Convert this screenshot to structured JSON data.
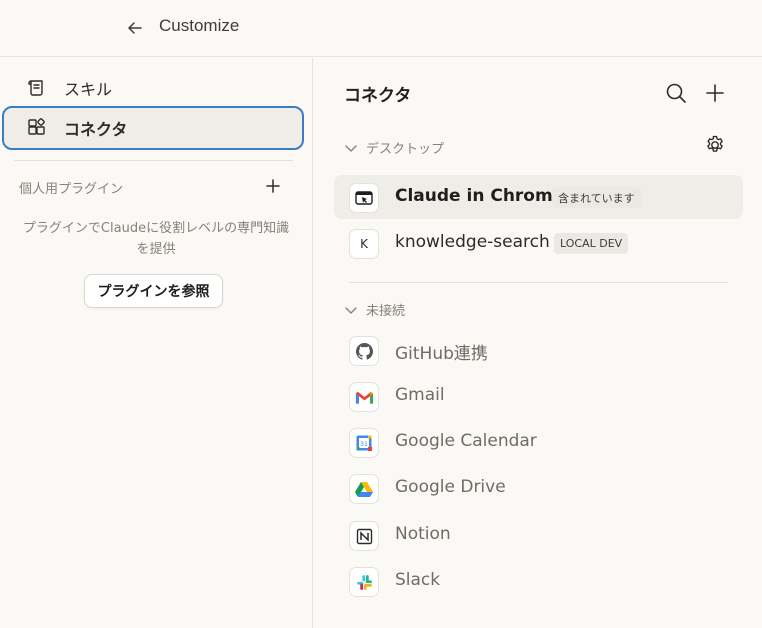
{
  "header": {
    "title": "Customize"
  },
  "sidebar": {
    "items": [
      {
        "label": "スキル"
      },
      {
        "label": "コネクタ"
      }
    ],
    "plugins": {
      "heading": "個人用プラグイン",
      "description": "プラグインでClaudeに役割レベルの専門知識を提供",
      "browse_label": "プラグインを参照"
    }
  },
  "main": {
    "title": "コネクタ",
    "desktop_section": {
      "label": "デスクトップ",
      "connectors": [
        {
          "name": "Claude in Chrome",
          "badge": "含まれています",
          "icon": "chrome-extension-icon"
        },
        {
          "name": "knowledge-search",
          "badge": "LOCAL DEV",
          "icon_letter": "K"
        }
      ]
    },
    "disconnected_section": {
      "label": "未接続",
      "connectors": [
        {
          "name": "GitHub連携",
          "icon": "github-icon"
        },
        {
          "name": "Gmail",
          "icon": "gmail-icon"
        },
        {
          "name": "Google Calendar",
          "icon": "google-calendar-icon"
        },
        {
          "name": "Google Drive",
          "icon": "google-drive-icon"
        },
        {
          "name": "Notion",
          "icon": "notion-icon"
        },
        {
          "name": "Slack",
          "icon": "slack-icon"
        }
      ]
    }
  },
  "colors": {
    "accent": "#3b7cc4",
    "background": "#faf9f5",
    "selected": "#efede7"
  }
}
